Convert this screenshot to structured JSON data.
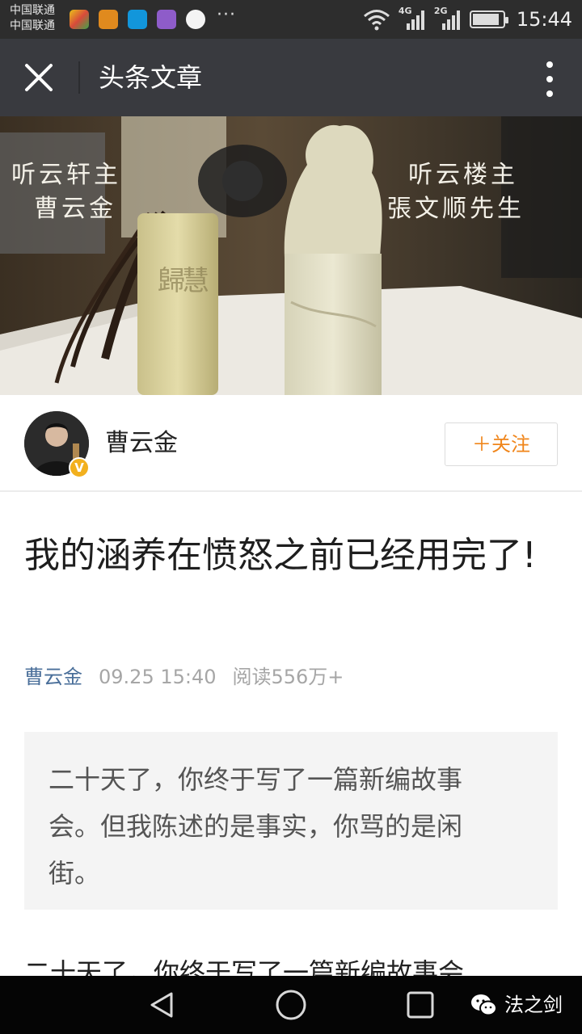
{
  "status_bar": {
    "carriers": [
      "中国联通",
      "中国联通"
    ],
    "notification_icons": [
      "photo-app-icon",
      "wallet-app-icon",
      "alipay-icon",
      "gallery-app-icon",
      "qq-icon"
    ],
    "overflow": "···",
    "signal_1": "4G",
    "signal_2": "2G",
    "battery_level": 0.9,
    "time": "15:44"
  },
  "title_bar": {
    "title": "头条文章"
  },
  "banner": {
    "caption_left_line1": "听云轩主",
    "caption_left_line2": "曹云金",
    "caption_right_line1": "听云楼主",
    "caption_right_line2": "張文顺先生"
  },
  "author": {
    "name": "曹云金",
    "verified_badge": "V",
    "follow_label": "＋关注"
  },
  "article": {
    "title": "我的涵养在愤怒之前已经用完了!",
    "meta_author": "曹云金",
    "meta_time": "09.25 15:40",
    "meta_reads": "阅读556万+",
    "quote": "二十天了，你终于写了一篇新编故事会。但我陈述的是事实，你骂的是闲街。",
    "body_preview": "二十天了，你终于写了一篇新编故事会"
  },
  "nav_bar": {
    "watermark": "法之剑"
  },
  "colors": {
    "status_bar": "#2d2d2d",
    "title_bar": "#393a3f",
    "follow_accent": "#f0851a",
    "meta_author": "#4a6f9a",
    "badge": "#f2b01e",
    "quote_bg": "#f4f4f4"
  }
}
